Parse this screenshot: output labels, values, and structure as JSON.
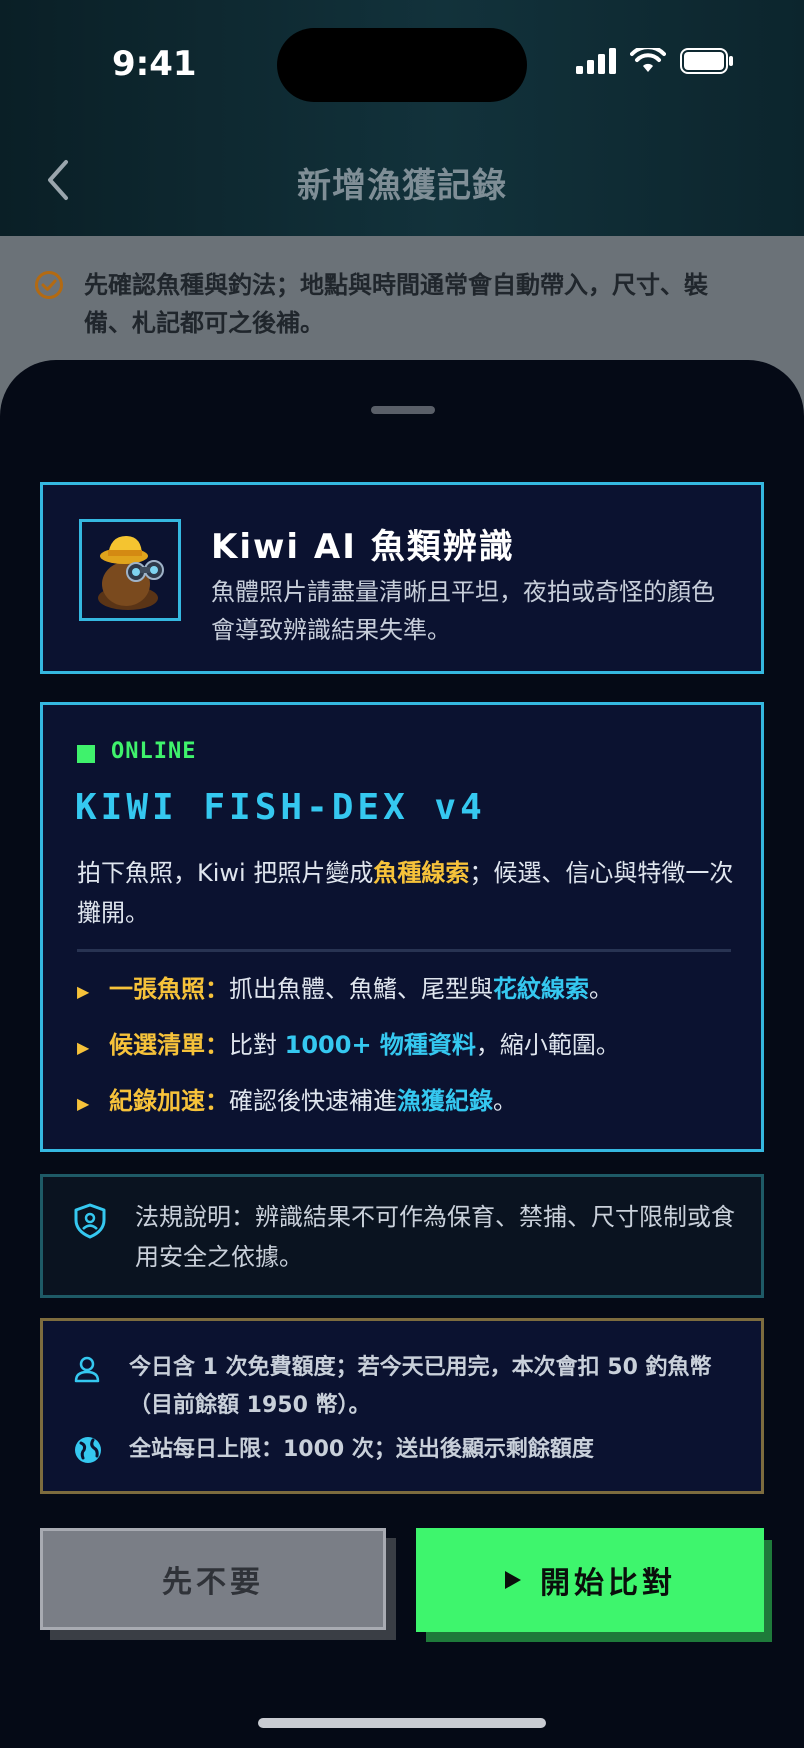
{
  "status_bar": {
    "time": "9:41"
  },
  "nav": {
    "title": "新增漁獲記錄"
  },
  "tip": {
    "text": "先確認魚種與釣法；地點與時間通常會自動帶入，尺寸、裝備、札記都可之後補。"
  },
  "ai_card": {
    "title": "Kiwi AI 魚類辨識",
    "desc": "魚體照片請盡量清晰且平坦，夜拍或奇怪的顏色會導致辨識結果失準。"
  },
  "dex_card": {
    "status": "ONLINE",
    "title": "KIWI FISH-DEX v4",
    "intro_a": "拍下魚照，Kiwi 把照片變成",
    "intro_hl": "魚種線索",
    "intro_b": "；候選、信心與特徵一次攤開。",
    "bullets": [
      {
        "label": "一張魚照：",
        "text_a": "抓出魚體、魚鰭、尾型與",
        "hl": "花紋線索",
        "text_b": "。"
      },
      {
        "label": "候選清單：",
        "text_a": "比對 ",
        "hl": "1000+ 物種資料",
        "text_b": "，縮小範圍。"
      },
      {
        "label": "紀錄加速：",
        "text_a": "確認後快速補進",
        "hl": "漁獲紀錄",
        "text_b": "。"
      }
    ]
  },
  "law": {
    "text": "法規說明：辨識結果不可作為保育、禁捕、尺寸限制或食用安全之依據。"
  },
  "quota": {
    "line1": "今日含 1 次免費額度；若今天已用完，本次會扣 50 釣魚幣（目前餘額 1950 幣）。",
    "line2": "全站每日上限：1000 次；送出後顯示剩餘額度"
  },
  "buttons": {
    "cancel": "先不要",
    "start": "開始比對"
  },
  "colors": {
    "accent_cyan": "#35b8e0",
    "accent_green": "#3ef56d",
    "accent_yellow": "#f6c23a"
  }
}
